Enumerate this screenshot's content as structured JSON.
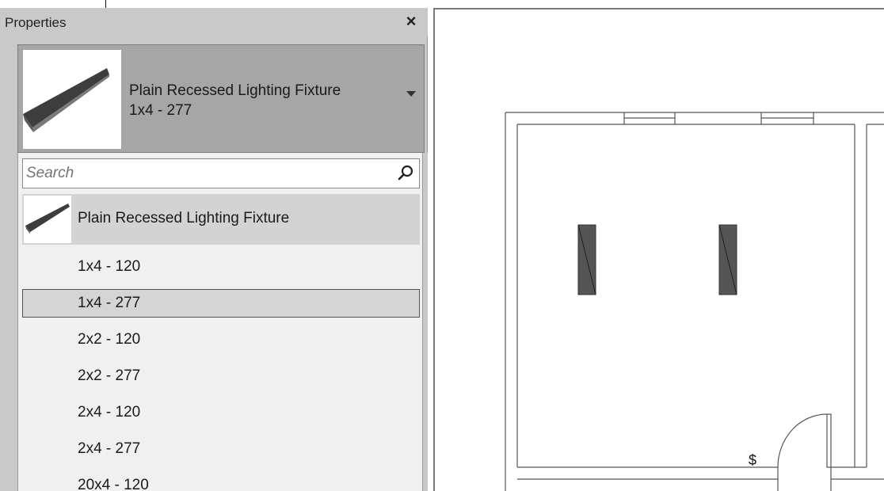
{
  "properties_palette": {
    "title": "Properties",
    "close_glyph": "×",
    "type_selector": {
      "family_name": "Plain Recessed Lighting Fixture",
      "type_name": "1x4 - 277"
    },
    "search": {
      "value": "",
      "placeholder": "Search"
    },
    "family": {
      "label": "Plain Recessed Lighting Fixture"
    },
    "types": [
      {
        "label": "1x4 - 120",
        "selected": false
      },
      {
        "label": "1x4 - 277",
        "selected": true
      },
      {
        "label": "2x2 - 120",
        "selected": false
      },
      {
        "label": "2x2 - 277",
        "selected": false
      },
      {
        "label": "2x4 - 120",
        "selected": false
      },
      {
        "label": "2x4 - 277",
        "selected": false
      },
      {
        "label": "20x4 - 120",
        "selected": false
      }
    ]
  },
  "drawing": {
    "switch_symbol": "$"
  },
  "icons": {
    "search": "search-icon",
    "close": "close-icon",
    "dropdown": "chevron-down-icon",
    "fixture_thumbnail": "lighting-fixture-icon"
  }
}
